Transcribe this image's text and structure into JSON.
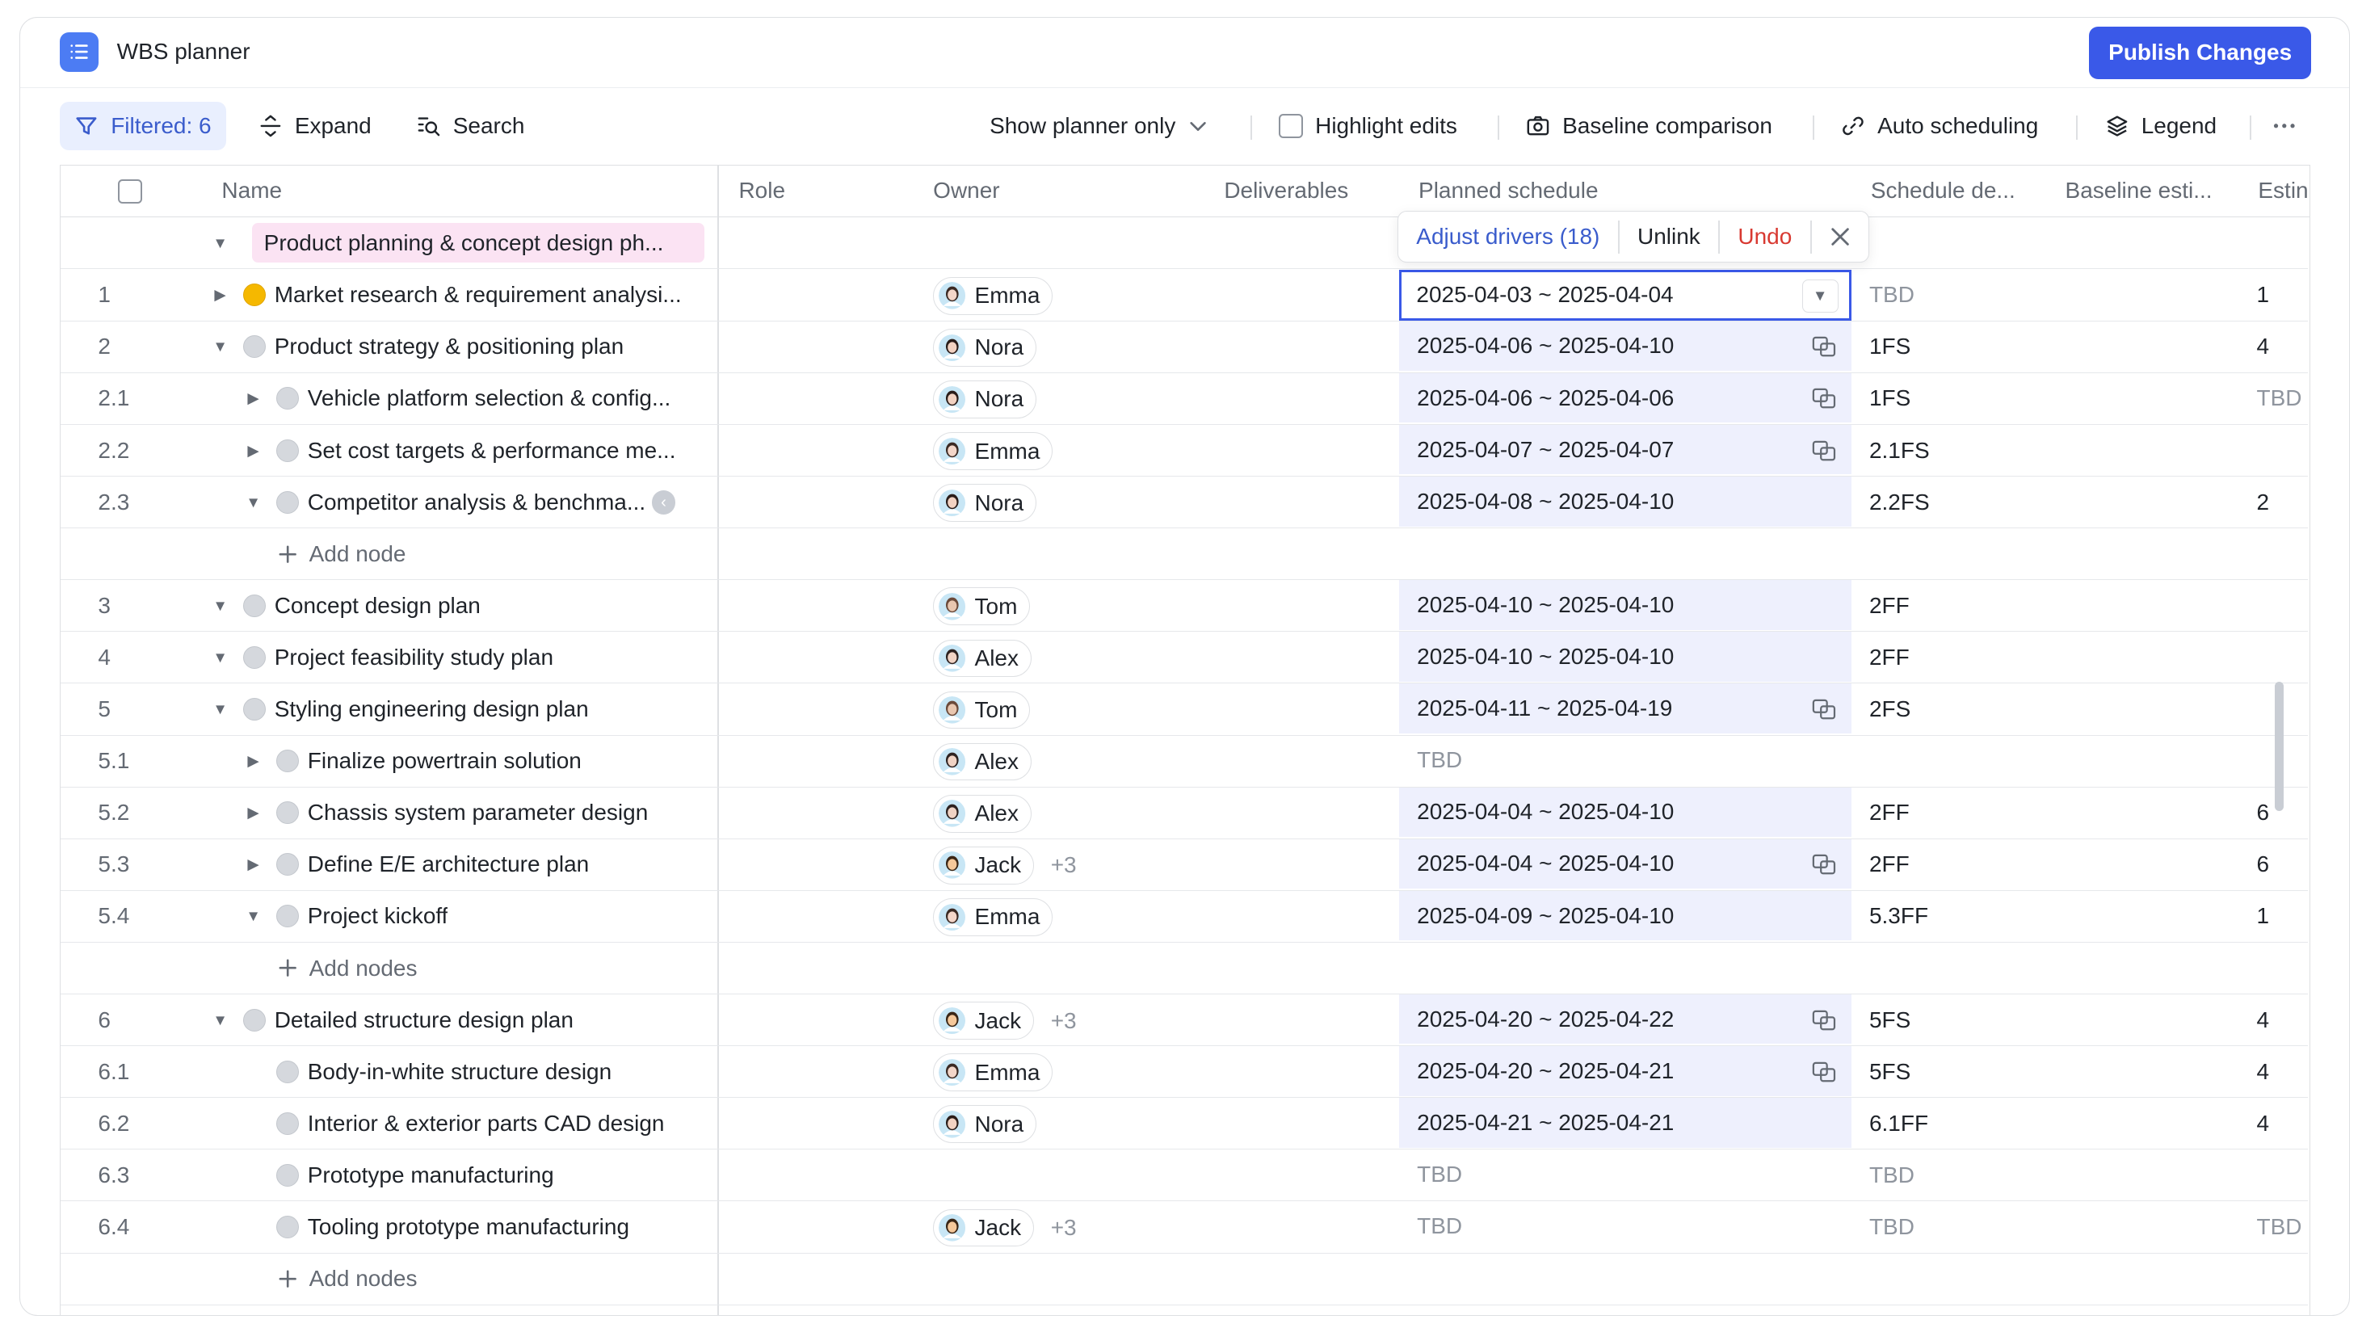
{
  "app": {
    "title": "WBS planner",
    "publish_label": "Publish Changes"
  },
  "toolbar": {
    "filtered": "Filtered: 6",
    "expand": "Expand",
    "search": "Search",
    "show_planner": "Show planner only",
    "highlight_edits": "Highlight edits",
    "baseline_comparison": "Baseline comparison",
    "auto_scheduling": "Auto scheduling",
    "legend": "Legend"
  },
  "columns": {
    "name": "Name",
    "role": "Role",
    "owner": "Owner",
    "deliverables": "Deliverables",
    "planned_schedule": "Planned schedule",
    "schedule_deps": "Schedule de...",
    "baseline_est": "Baseline esti...",
    "estimate": "Estin"
  },
  "group": {
    "label": "Product planning & concept design ph..."
  },
  "popover": {
    "adjust": "Adjust drivers (18)",
    "unlink": "Unlink",
    "undo": "Undo"
  },
  "add_node": "Add node",
  "add_nodes": "Add nodes",
  "rows": [
    {
      "num": "1",
      "name": "Market research & requirement analysi...",
      "owner": "Emma",
      "extra": "",
      "schedule": "2025-04-03 ~ 2025-04-04",
      "dep": "TBD",
      "est": "1"
    },
    {
      "num": "2",
      "name": "Product strategy & positioning plan",
      "owner": "Nora",
      "extra": "",
      "schedule": "2025-04-06 ~ 2025-04-10",
      "dep": "1FS",
      "est": "4"
    },
    {
      "num": "2.1",
      "name": "Vehicle platform selection & config...",
      "owner": "Nora",
      "extra": "",
      "schedule": "2025-04-06 ~ 2025-04-06",
      "dep": "1FS",
      "est": "TBD"
    },
    {
      "num": "2.2",
      "name": "Set cost targets & performance me...",
      "owner": "Emma",
      "extra": "",
      "schedule": "2025-04-07 ~ 2025-04-07",
      "dep": "2.1FS",
      "est": ""
    },
    {
      "num": "2.3",
      "name": "Competitor analysis & benchma...",
      "owner": "Nora",
      "extra": "",
      "schedule": "2025-04-08 ~ 2025-04-10",
      "dep": "2.2FS",
      "est": "2"
    },
    {
      "num": "3",
      "name": "Concept design plan",
      "owner": "Tom",
      "extra": "",
      "schedule": "2025-04-10 ~ 2025-04-10",
      "dep": "2FF",
      "est": ""
    },
    {
      "num": "4",
      "name": "Project feasibility study plan",
      "owner": "Alex",
      "extra": "",
      "schedule": "2025-04-10 ~ 2025-04-10",
      "dep": "2FF",
      "est": ""
    },
    {
      "num": "5",
      "name": "Styling engineering design plan",
      "owner": "Tom",
      "extra": "",
      "schedule": "2025-04-11 ~ 2025-04-19",
      "dep": "2FS",
      "est": ""
    },
    {
      "num": "5.1",
      "name": "Finalize powertrain solution",
      "owner": "Alex",
      "extra": "",
      "schedule": "TBD",
      "dep": "",
      "est": ""
    },
    {
      "num": "5.2",
      "name": "Chassis system parameter design",
      "owner": "Alex",
      "extra": "",
      "schedule": "2025-04-04 ~ 2025-04-10",
      "dep": "2FF",
      "est": "6"
    },
    {
      "num": "5.3",
      "name": "Define E/E architecture plan",
      "owner": "Jack",
      "extra": "+3",
      "schedule": "2025-04-04 ~ 2025-04-10",
      "dep": "2FF",
      "est": "6"
    },
    {
      "num": "5.4",
      "name": "Project kickoff",
      "owner": "Emma",
      "extra": "",
      "schedule": "2025-04-09 ~ 2025-04-10",
      "dep": "5.3FF",
      "est": "1"
    },
    {
      "num": "6",
      "name": "Detailed structure design plan",
      "owner": "Jack",
      "extra": "+3",
      "schedule": "2025-04-20 ~ 2025-04-22",
      "dep": "5FS",
      "est": "4"
    },
    {
      "num": "6.1",
      "name": "Body-in-white structure design",
      "owner": "Emma",
      "extra": "",
      "schedule": "2025-04-20 ~ 2025-04-21",
      "dep": "5FS",
      "est": "4"
    },
    {
      "num": "6.2",
      "name": "Interior & exterior parts CAD design",
      "owner": "Nora",
      "extra": "",
      "schedule": "2025-04-21 ~ 2025-04-21",
      "dep": "6.1FF",
      "est": "4"
    },
    {
      "num": "6.3",
      "name": "Prototype manufacturing",
      "owner": "",
      "extra": "",
      "schedule": "TBD",
      "dep": "TBD",
      "est": ""
    },
    {
      "num": "6.4",
      "name": "Tooling prototype manufacturing",
      "owner": "Jack",
      "extra": "+3",
      "schedule": "TBD",
      "dep": "TBD",
      "est": "TBD"
    }
  ],
  "colors": {
    "accent": "#3a59e8",
    "schedule_bg": "#eef0fd",
    "group_tag": "#fbe3f3",
    "undo": "#d83931"
  }
}
